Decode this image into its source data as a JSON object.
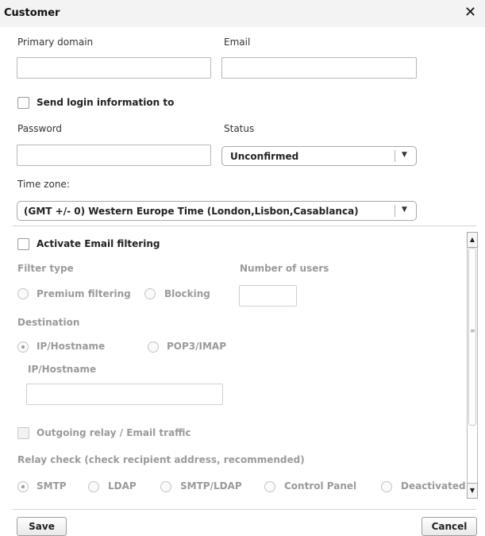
{
  "dialog": {
    "title": "Customer",
    "close_glyph": "✕"
  },
  "fields": {
    "primary_domain_label": "Primary domain",
    "primary_domain_value": "",
    "email_label": "Email",
    "email_value": "",
    "send_login_label": "Send login information to",
    "password_label": "Password",
    "password_value": "",
    "status_label": "Status",
    "status_value": "Unconfirmed",
    "timezone_label": "Time zone:",
    "timezone_value": "(GMT +/- 0)  Western Europe Time (London,Lisbon,Casablanca)"
  },
  "filtering": {
    "activate_label": "Activate Email filtering",
    "activate_checked": false,
    "filter_type_label": "Filter type",
    "premium_label": "Premium filtering",
    "blocking_label": "Blocking",
    "number_users_label": "Number of users",
    "number_users_value": "",
    "destination_label": "Destination",
    "ip_hostname_option": "IP/Hostname",
    "pop3_option": "POP3/IMAP",
    "ip_hostname_field_label": "IP/Hostname",
    "ip_hostname_value": "",
    "destination_selected": "IP/Hostname",
    "outgoing_relay_label": "Outgoing relay / Email traffic",
    "relay_check_label": "Relay check (check recipient address, recommended)",
    "relay_options": [
      "SMTP",
      "LDAP",
      "SMTP/LDAP",
      "Control Panel",
      "Deactivated"
    ],
    "relay_selected": "SMTP"
  },
  "scrollbar": {
    "up_glyph": "▲",
    "down_glyph": "▼",
    "grip_glyph": "≡"
  },
  "select_arrow_glyph": "▼",
  "buttons": {
    "save": "Save",
    "cancel": "Cancel"
  },
  "icons": {
    "close": "close-icon",
    "select_arrow": "chevron-down-icon",
    "scroll_up": "arrow-up-icon",
    "scroll_down": "arrow-down-icon"
  },
  "colors": {
    "title_bar_bg": "#f3f3f3",
    "disabled_text": "#9a9a9a"
  }
}
